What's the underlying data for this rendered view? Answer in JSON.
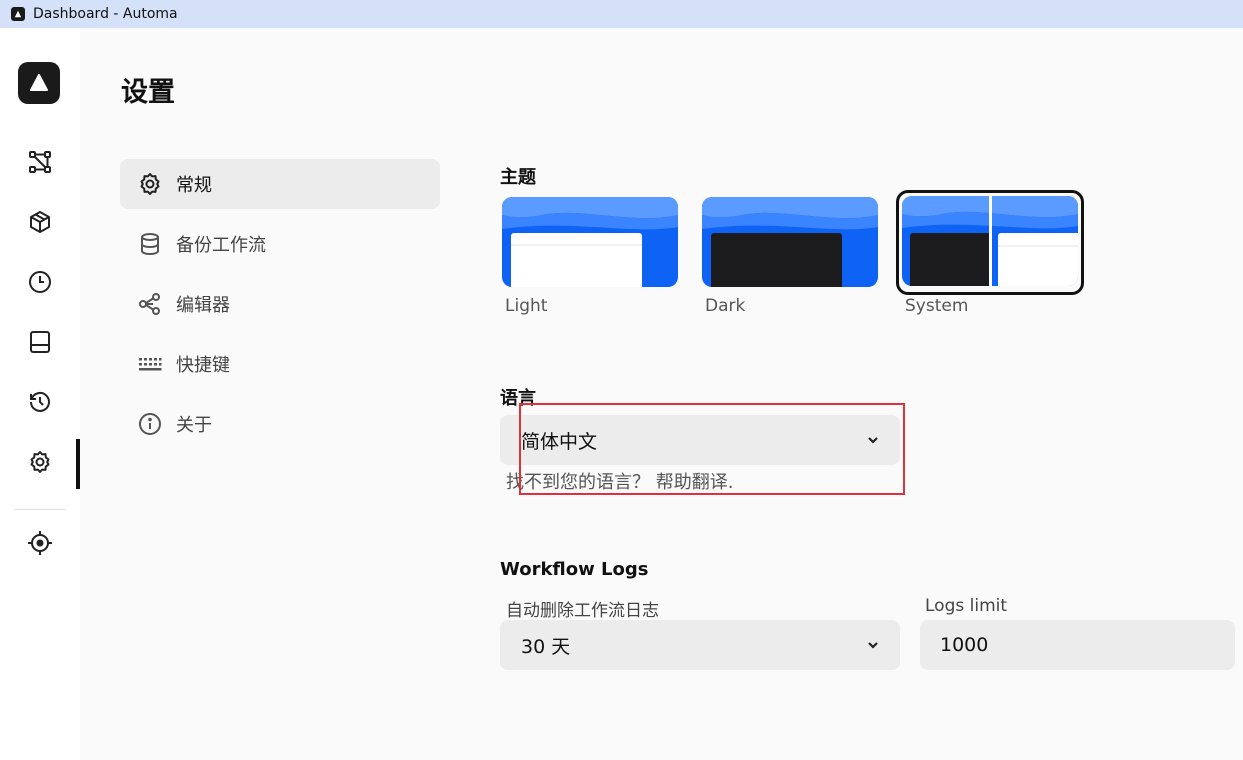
{
  "window": {
    "title": "Dashboard - Automa"
  },
  "rail": {
    "items": [
      {
        "name": "workflows",
        "icon": "flow-icon"
      },
      {
        "name": "packages",
        "icon": "cube-icon"
      },
      {
        "name": "schedules",
        "icon": "clock-icon"
      },
      {
        "name": "storage",
        "icon": "storage-icon"
      },
      {
        "name": "logs",
        "icon": "history-icon"
      },
      {
        "name": "settings",
        "icon": "gear-icon",
        "active": true
      },
      {
        "name": "element-picker",
        "icon": "crosshair-icon"
      }
    ]
  },
  "page": {
    "title": "设置"
  },
  "nav": {
    "items": [
      {
        "label": "常规",
        "icon": "gear-icon",
        "active": true
      },
      {
        "label": "备份工作流",
        "icon": "database-icon"
      },
      {
        "label": "编辑器",
        "icon": "nodes-icon"
      },
      {
        "label": "快捷键",
        "icon": "keyboard-icon"
      },
      {
        "label": "关于",
        "icon": "info-icon"
      }
    ]
  },
  "theme": {
    "heading": "主题",
    "options": [
      {
        "label": "Light"
      },
      {
        "label": "Dark"
      },
      {
        "label": "System",
        "selected": true
      }
    ]
  },
  "language": {
    "heading": "语言",
    "selected": "简体中文",
    "help_prefix": "找不到您的语言？",
    "help_link": "帮助翻译."
  },
  "logs": {
    "heading": "Workflow Logs",
    "auto_delete_label": "自动删除工作流日志",
    "auto_delete_value": "30 天",
    "limit_label": "Logs limit",
    "limit_value": "1000"
  },
  "colors": {
    "accent_blue": "#0e63f5",
    "annotation": "#e0303a"
  }
}
